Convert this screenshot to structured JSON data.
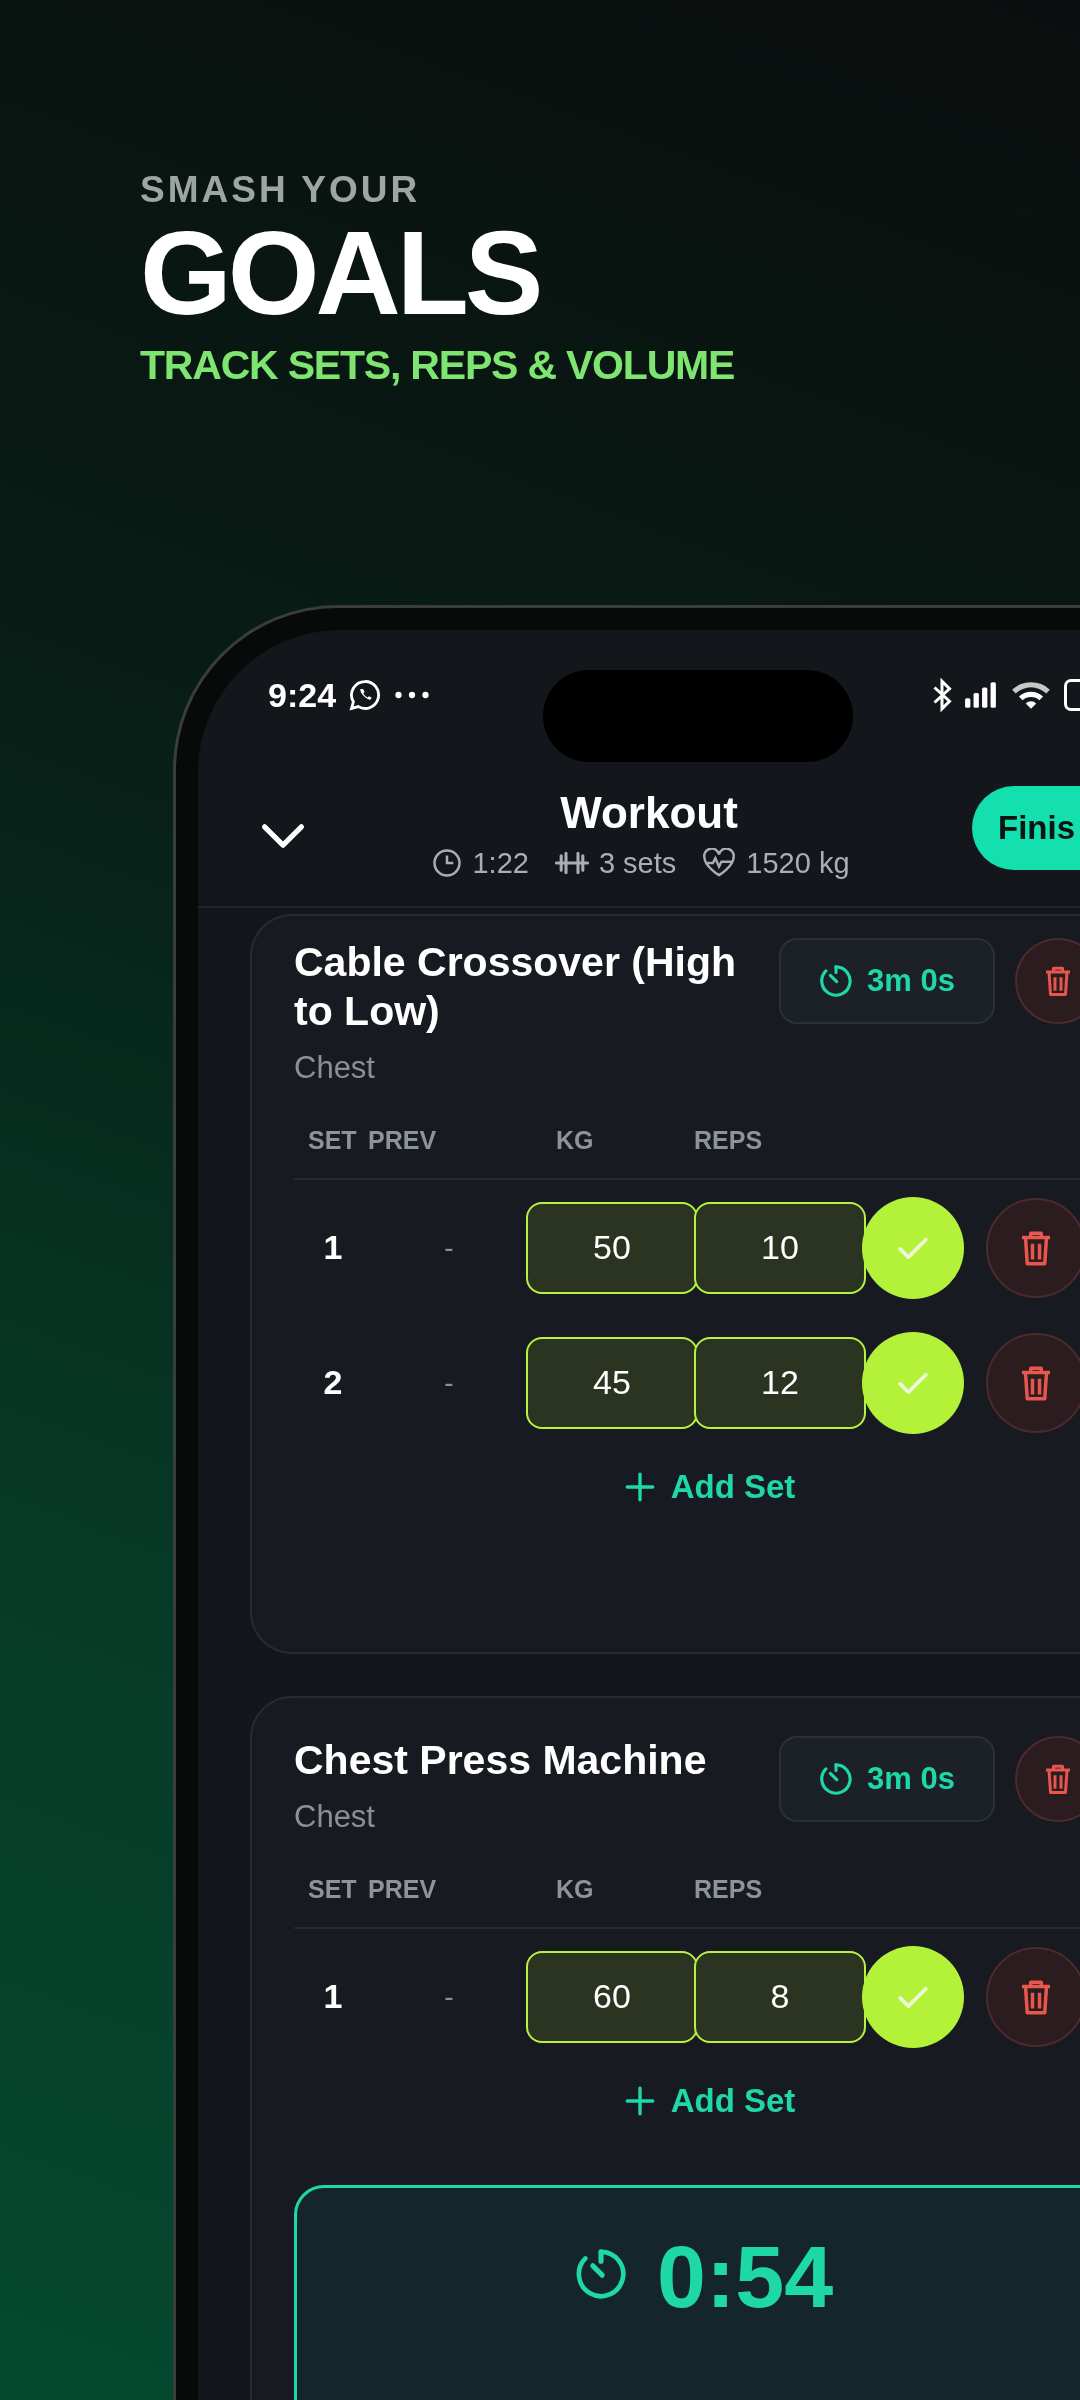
{
  "headline": {
    "eyebrow": "SMASH YOUR",
    "title": "GOALS",
    "tagline": "TRACK SETS, REPS & VOLUME"
  },
  "status_bar": {
    "time": "9:24"
  },
  "header": {
    "title": "Workout",
    "finish_button": "Finis",
    "stats": [
      {
        "kind": "time",
        "text": "1:22"
      },
      {
        "kind": "sets",
        "text": "3 sets"
      },
      {
        "kind": "volume",
        "text": "1520 kg"
      }
    ]
  },
  "exercises": [
    {
      "name": "Cable Crossover (High to Low)",
      "muscle": "Chest",
      "rest": "3m 0s",
      "columns": [
        "SET",
        "PREV",
        "KG",
        "REPS"
      ],
      "add_set": "Add Set",
      "sets": [
        {
          "set": "1",
          "prev": "-",
          "kg": "50",
          "reps": "10",
          "completed": true
        },
        {
          "set": "2",
          "prev": "-",
          "kg": "45",
          "reps": "12",
          "completed": true
        }
      ]
    },
    {
      "name": "Chest Press Machine",
      "muscle": "Chest",
      "rest": "3m 0s",
      "columns": [
        "SET",
        "PREV",
        "KG",
        "REPS"
      ],
      "add_set": "Add Set",
      "sets": [
        {
          "set": "1",
          "prev": "-",
          "kg": "60",
          "reps": "8",
          "completed": true
        }
      ]
    }
  ],
  "rest_timer": {
    "time": "0:54"
  }
}
